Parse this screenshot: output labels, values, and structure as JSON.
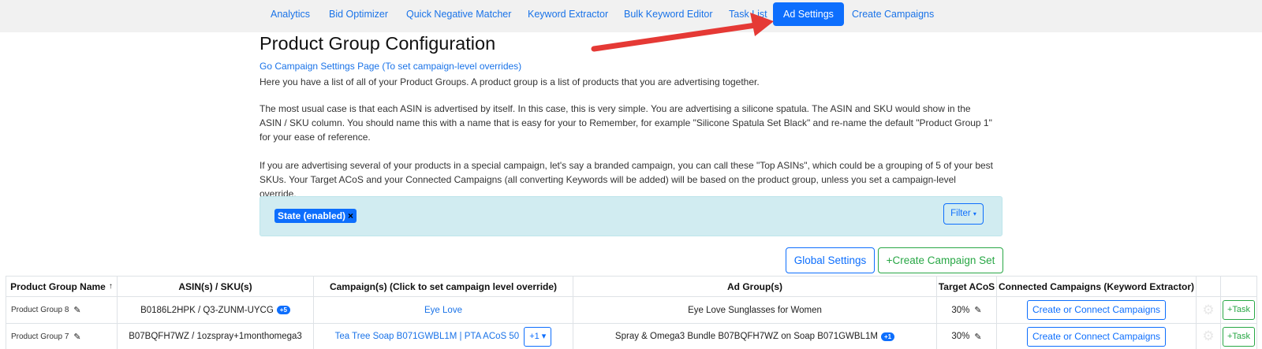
{
  "nav": {
    "items": [
      {
        "label": "Analytics",
        "active": false
      },
      {
        "label": "Bid Optimizer",
        "active": false
      },
      {
        "label": "Quick Negative Matcher",
        "active": false
      },
      {
        "label": "Keyword Extractor",
        "active": false
      },
      {
        "label": "Bulk Keyword Editor",
        "active": false
      },
      {
        "label": "Task List",
        "active": false
      },
      {
        "label": "Ad Settings",
        "active": true
      },
      {
        "label": "Create Campaigns",
        "active": false
      }
    ]
  },
  "page": {
    "title": "Product Group Configuration",
    "settings_link": "Go Campaign Settings Page (To set campaign-level overrides)",
    "paragraphs": [
      "Here you have a list of all of your Product Groups. A product group is a list of products that you are advertising together.",
      "The most usual case is that each ASIN is advertised by itself. In this case, this is very simple. You are advertising a silicone spatula. The ASIN and SKU would show in the ASIN / SKU column. You should name this with a name that is easy for your to Remember, for example \"Silicone Spatula Set Black\" and re-name the default \"Product Group 1\" for your ease of reference.",
      "If you are advertising several of your products in a special campaign, let's say a branded campaign, you can call these \"Top ASINs\", which could be a grouping of 5 of your best SKUs. Your Target ACoS and your Connected Campaigns (all converting Keywords will be added) will be based on the product group, unless you set a campaign-level override."
    ]
  },
  "filter": {
    "chip_label": "State (enabled)",
    "chip_close": "×",
    "button_label": "Filter",
    "caret": "▾"
  },
  "actions": {
    "global_settings": "Global Settings",
    "create_campaign_set": "+Create Campaign Set"
  },
  "table": {
    "headers": {
      "name": "Product Group Name",
      "sort_indicator": "↑",
      "asin": "ASIN(s) / SKU(s)",
      "campaigns": "Campaign(s) (Click to set campaign level override)",
      "ad_groups": "Ad Group(s)",
      "target_acos": "Target ACoS",
      "connected": "Connected Campaigns (Keyword Extractor)"
    },
    "rows": [
      {
        "name": "Product Group 8",
        "asin": "B0186L2HPK / Q3-ZUNM-UYCG",
        "asin_badge": "+5",
        "campaign": "Eye Love",
        "campaign_more": "",
        "ad_group": "Eye Love Sunglasses for Women",
        "ad_group_badge": "",
        "acos": "30%",
        "connect_label": "Create or Connect Campaigns",
        "task_label": "+Task"
      },
      {
        "name": "Product Group 7",
        "asin": "B07BQFH7WZ / 1ozspray+1monthomega3",
        "asin_badge": "",
        "campaign": "Tea Tree Soap B071GWBL1M | PTA ACoS 50",
        "campaign_more": "+1 ▾",
        "ad_group": "Spray & Omega3 Bundle B07BQFH7WZ on Soap B071GWBL1M",
        "ad_group_badge": "+1",
        "acos": "30%",
        "connect_label": "Create or Connect Campaigns",
        "task_label": "+Task"
      }
    ]
  },
  "icons": {
    "pencil": "✎",
    "gear": "⚙"
  },
  "colors": {
    "primary": "#0d6efd",
    "success": "#28a745",
    "filter_bg": "#d1ecf1",
    "arrow": "#e53935"
  }
}
